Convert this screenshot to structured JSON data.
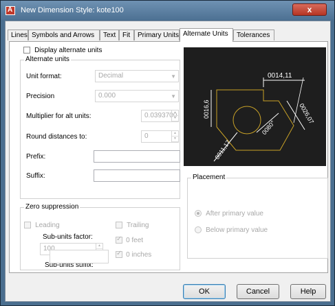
{
  "window": {
    "title": "New Dimension Style: kote100",
    "close_label": "x"
  },
  "tabs": [
    "Lines",
    "Symbols and Arrows",
    "Text",
    "Fit",
    "Primary Units",
    "Alternate Units",
    "Tolerances"
  ],
  "active_tab": "Alternate Units",
  "display_alt_units": {
    "label": "Display alternate units",
    "checked": false
  },
  "alternate_units": {
    "title": "Alternate units",
    "unit_format": {
      "label": "Unit format:",
      "value": "Decimal"
    },
    "precision": {
      "label": "Precision",
      "value": "0.000"
    },
    "multiplier": {
      "label": "Multiplier for alt units:",
      "value": "0.0393700"
    },
    "round": {
      "label": "Round distances  to:",
      "value": "0"
    },
    "prefix": {
      "label": "Prefix:",
      "value": ""
    },
    "suffix": {
      "label": "Suffix:",
      "value": ""
    }
  },
  "zero_suppression": {
    "title": "Zero suppression",
    "leading": "Leading",
    "trailing": "Trailing",
    "sub_units_factor_label": "Sub-units factor:",
    "sub_units_factor_value": "100",
    "zero_feet": "0 feet",
    "zero_inches": "0 inches",
    "sub_units_suffix_label": "Sub-units suffix:",
    "sub_units_suffix_value": ""
  },
  "preview": {
    "dims": [
      "0014,11",
      "0016,6",
      "0026,07",
      "0080°",
      "0011,17"
    ],
    "colors": {
      "background": "#1e1e1e",
      "part": "#c9a227",
      "dimension": "#ffffff"
    }
  },
  "placement": {
    "title": "Placement",
    "after": "After primary value",
    "below": "Below primary value",
    "selected": "after"
  },
  "buttons": {
    "ok": "OK",
    "cancel": "Cancel",
    "help": "Help"
  }
}
